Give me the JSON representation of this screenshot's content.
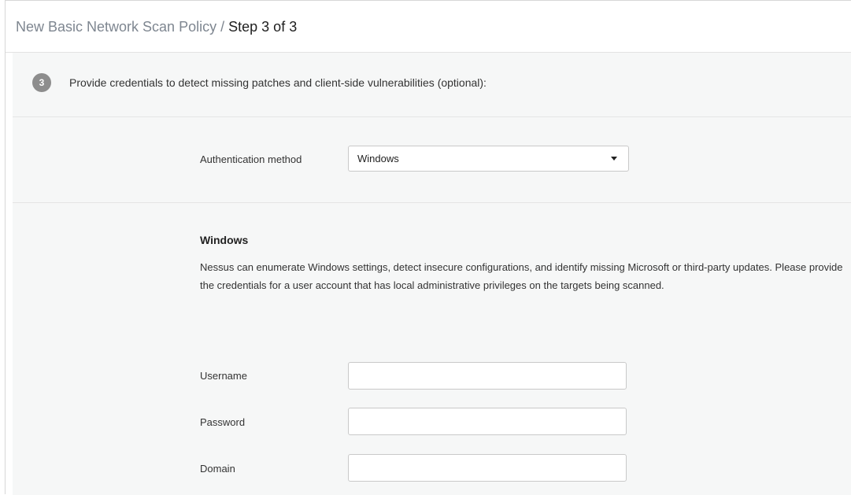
{
  "header": {
    "title_base": "New Basic Network Scan Policy",
    "separator": "/",
    "title_step": "Step 3 of 3"
  },
  "step": {
    "number": "3",
    "text": "Provide credentials to detect missing patches and client-side vulnerabilities (optional):"
  },
  "auth": {
    "label": "Authentication method",
    "selected": "Windows"
  },
  "windows": {
    "title": "Windows",
    "description": "Nessus can enumerate Windows settings, detect insecure configurations, and identify missing Microsoft or third-party updates. Please provide the credentials for a user account that has local administrative privileges on the targets being scanned."
  },
  "fields": {
    "username": {
      "label": "Username",
      "value": ""
    },
    "password": {
      "label": "Password",
      "value": ""
    },
    "domain": {
      "label": "Domain",
      "value": ""
    }
  },
  "colors": {
    "band_background": "#f6f7f7",
    "step_badge": "#8d8d8d",
    "title_muted": "#7e8690"
  }
}
